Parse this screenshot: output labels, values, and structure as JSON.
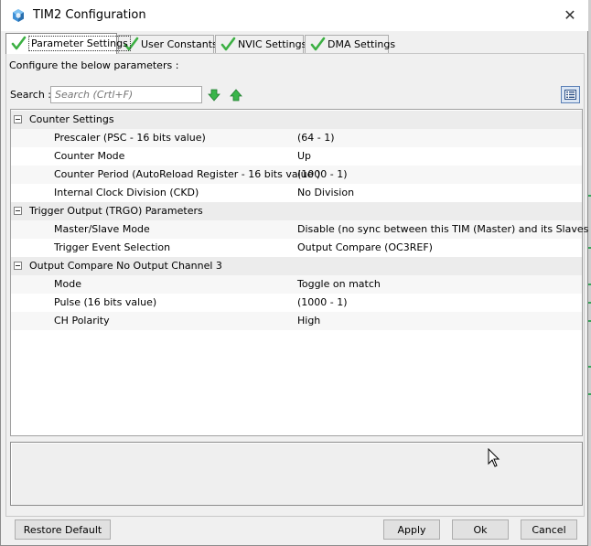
{
  "window": {
    "title": "TIM2 Configuration"
  },
  "tabs": [
    {
      "label": "Parameter Settings",
      "active": true
    },
    {
      "label": "User Constants",
      "active": false
    },
    {
      "label": "NVIC Settings",
      "active": false
    },
    {
      "label": "DMA Settings",
      "active": false
    }
  ],
  "panel": {
    "configure_text": "Configure the below parameters :",
    "search_label": "Search :",
    "search_placeholder": "Search (Crtl+F)",
    "search_value": ""
  },
  "groups": [
    {
      "label": "Counter Settings",
      "params": [
        {
          "name": "Prescaler (PSC - 16 bits value)",
          "value": "(64 - 1)"
        },
        {
          "name": "Counter Mode",
          "value": "Up"
        },
        {
          "name": "Counter Period (AutoReload Register - 16 bits value )",
          "value": "(1000 - 1)"
        },
        {
          "name": "Internal Clock Division (CKD)",
          "value": "No Division"
        }
      ]
    },
    {
      "label": "Trigger Output (TRGO) Parameters",
      "params": [
        {
          "name": "Master/Slave Mode",
          "value": "Disable (no sync between this TIM (Master) and its Slaves"
        },
        {
          "name": "Trigger Event Selection",
          "value": "Output Compare (OC3REF)"
        }
      ]
    },
    {
      "label": "Output Compare No Output Channel 3",
      "params": [
        {
          "name": "Mode",
          "value": "Toggle on match"
        },
        {
          "name": "Pulse (16 bits value)",
          "value": "(1000 - 1)"
        },
        {
          "name": "CH Polarity",
          "value": "High"
        }
      ]
    }
  ],
  "buttons": {
    "restore_default": "Restore Default",
    "apply": "Apply",
    "ok": "Ok",
    "cancel": "Cancel"
  },
  "icons": {
    "app": "cube-icon",
    "close": "close-icon",
    "tab_check": "checkmark-icon",
    "search_next": "arrow-down-icon",
    "search_prev": "arrow-up-icon",
    "view_toggle": "list-view-icon",
    "cursor": "mouse-pointer-icon"
  },
  "colors": {
    "check_green": "#3cb043",
    "arrow_green": "#39b54a",
    "group_row_bg": "#ececec",
    "view_btn_border": "#5a7fb5"
  }
}
